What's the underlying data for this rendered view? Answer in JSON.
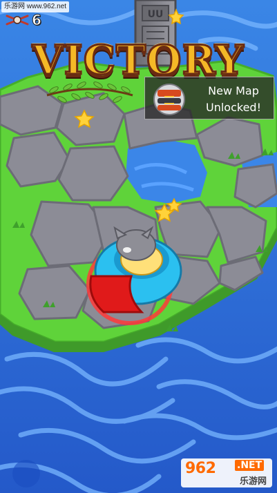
{
  "watermark_top": {
    "text": "乐游网 www.962.net"
  },
  "hud": {
    "kills": "6"
  },
  "victory": {
    "title": "VICTORY"
  },
  "unlock": {
    "line1": "New Map",
    "line2": "Unlocked!"
  },
  "watermark_bottom": {
    "brand": "962",
    "tld": ".NET",
    "sub": "乐游网"
  },
  "colors": {
    "water": "#2a6fd0",
    "grass": "#5fd33a",
    "stone": "#8a8a94",
    "title_fill": "#f4b827",
    "title_outline": "#6a2b12",
    "bumper_blue": "#2bc0f0",
    "bumper_red": "#e01a1a"
  }
}
